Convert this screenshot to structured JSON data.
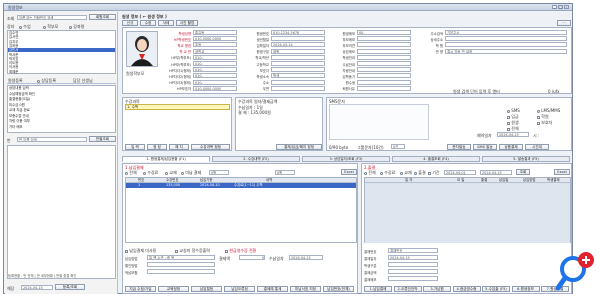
{
  "window": {
    "title": "원생정보",
    "controls": [
      "_",
      "□",
      "×"
    ]
  },
  "left": {
    "search_label": "조회",
    "search_placeholder": "이름 또는 전화번호 검색",
    "search_btn": "회원조회",
    "class_label": "강좌",
    "class_opts": [
      "수업",
      "학부모",
      "강좌명"
    ],
    "list_items": [
      "김수연",
      "김서연",
      "김지우",
      "김하윤",
      "김민서",
      "박서준",
      "박지호",
      "이도윤",
      "이서윤",
      "최예준"
    ],
    "selected_index": 4,
    "tab_a": "원생등록",
    "tab_b": "상담등록",
    "tab_c": "담당 선생님",
    "info_rows": [
      "상담내용 입력",
      "수납예정금액 확인",
      "출결현황(오늘)",
      "미수금 0원",
      "교재 지급 완료",
      "보충수업 안내",
      "차량 이용 여부",
      "기타 메모"
    ],
    "search2_label": "반",
    "search2_placeholder": "반 이름 검색",
    "search2_btn": "반별조회",
    "status_text": "등록현황 : 반 전체 | 반 세부현황 | 반별 출결 확인",
    "date_label": "해당",
    "date_value": "2024-04-15",
    "date_btn": "등록/조회"
  },
  "main": {
    "section_title": "원생 정보 ( ← 원생 정보 )",
    "toolbar": [
      "신규",
      "수정",
      "삭제",
      "사진 촬영"
    ],
    "more": "···",
    "photo_caption": "원생학부모",
    "fields_col1": [
      {
        "label": "학생성명",
        "value": "홍길동"
      },
      {
        "label": "HP학생번호",
        "value": "010-0000-0000"
      },
      {
        "label": "학교 명칭",
        "value": "초등"
      },
      {
        "label": "학 교 반",
        "value": "새학교"
      },
      {
        "label": "HP부(학부모)",
        "value": "010-"
      },
      {
        "label": "HP모(학부모)",
        "value": "010-"
      },
      {
        "label": "HP자녀1(형제)",
        "value": "010-"
      },
      {
        "label": "HP자녀2(형제)",
        "value": "010-"
      },
      {
        "label": "HP자녀3(형제)",
        "value": "010-"
      },
      {
        "label": "HP보호자",
        "value": "010-0000-0000"
      }
    ],
    "fields_col2": [
      {
        "label": "원생번호",
        "value": "010-1234-5678"
      },
      {
        "label": "생년월일",
        "value": ""
      },
      {
        "label": "입학일자",
        "value": "2024-03-14"
      },
      {
        "label": "원생구분",
        "value": "재원"
      },
      {
        "label": "학교/학년",
        "value": ""
      },
      {
        "label": "고등학교",
        "value": ""
      },
      {
        "label": "보호자",
        "value": ""
      },
      {
        "label": "학생소속",
        "value": "학생"
      },
      {
        "label": "주소",
        "value": ""
      },
      {
        "label": "우편",
        "value": ""
      }
    ],
    "fields_col3": [
      {
        "label": "원생메모",
        "value": "00-"
      },
      {
        "label": "부모메모",
        "value": ""
      },
      {
        "label": "부모의견",
        "value": ""
      },
      {
        "label": "상담메모",
        "value": ""
      },
      {
        "label": "학생안내",
        "value": ""
      },
      {
        "label": "수납안내",
        "value": ""
      },
      {
        "label": "차량안내",
        "value": ""
      },
      {
        "label": "입학동기",
        "value": ""
      },
      {
        "label": "원수생",
        "value": ""
      },
      {
        "label": "퇴원사유",
        "value": ""
      }
    ],
    "right_top": [
      {
        "label": "주소검색",
        "value": "기본주소"
      },
      {
        "label": "상세주소",
        "value": ""
      },
      {
        "label": "학 원",
        "value": ""
      },
      {
        "label": "반 명",
        "value": "결시 자동 반 설정"
      }
    ],
    "right_note": "원생 검색 단어 입력 후 엔터",
    "right_count": "0 /ufx"
  },
  "mid": {
    "left_title": "수강과목",
    "left_row": "1. 수학",
    "left_btns": [
      "입 력",
      "정 정",
      "해 지",
      "수강과목 정정"
    ],
    "center_title": "수강과목 일자/결제금액",
    "center_lines": [
      "수납일자 : 1일",
      "결 제 : 135,000원"
    ],
    "center_btn": "결제/입금/해지 정정",
    "right_title": "SMS문자",
    "right_opts": [
      "SMS",
      "LMS/MMS",
      "입금",
      "학원",
      "원생",
      "보호자",
      "전체"
    ],
    "right_sub": [
      "예약일자",
      "2024-04-15",
      "시 :"
    ],
    "right_bottom": [
      "0/90 byte",
      "그룹문자(10건)",
      "0건",
      "문자발송",
      "SMS 발송",
      "상품결제",
      "시간대"
    ]
  },
  "tabs": [
    "1. 원생결제/납입현황 (F1)",
    "2. 수강내역 (F2)",
    "3. 상담일자/조회 (F3)",
    "4. 출결조회 (F4)",
    "5. 발송결과 (F5)"
  ],
  "lower_left": {
    "title": "1.납입결제",
    "filters": [
      "전체",
      "수강료",
      "교재",
      "미납 결제",
      "0원",
      "0원",
      "Excel"
    ],
    "headers": [
      "번호",
      "수강번호",
      "납입기한",
      "내역"
    ],
    "row": [
      "1",
      "135,000",
      "2024-04-10",
      "수강료(1~11) 수학"
    ],
    "bottom_chk": [
      "납입결제 미사용",
      "교실미 정수증출력",
      "현금영수증 전환"
    ],
    "form_rows": [
      {
        "label": "납입방법",
        "value": "일 팬 소관 : 중 목"
      },
      {
        "label": "할인방법",
        "value": ""
      },
      {
        "label": "적납보험",
        "value": ""
      }
    ],
    "pay_label": "결제액",
    "pay_value": "0",
    "date_label": "수납일자",
    "date_value": "2024-04-15",
    "btns": [
      "지급 수정/가입",
      "교육정정",
      "납입철정",
      "납입오류정",
      "결제예 통계",
      "미납서표 지정",
      "납입번호(전체)"
    ]
  },
  "lower_right": {
    "title": "2.출결",
    "filters": [
      "전체",
      "수강료",
      "교재",
      "출결",
      "기간",
      "2024-04-01",
      "2024-04-15",
      "조회",
      "Excel"
    ],
    "headers": [
      "일 자",
      "요 일",
      "출결",
      "납입일",
      "납입방법",
      "학생결제"
    ],
    "form_rows": [
      {
        "label": "결제번호",
        "value": "결제번호"
      },
      {
        "label": "결재일자",
        "value": "2024-04-15"
      },
      {
        "label": "학생구분",
        "value": ""
      },
      {
        "label": "결제금액",
        "value": ""
      },
      {
        "label": "결제메모",
        "value": ""
      }
    ],
    "btns": [
      "1.납입결제",
      "2.오류안전작",
      "3.가납원",
      "4.현금영수증",
      "5.수입출 (F5)",
      "6.원생정보",
      "7.원생출결"
    ]
  },
  "colors": {
    "accent": "#3b6fd8",
    "red": "#c8102e",
    "selected": "#3a66c6",
    "zoom": "#1e73e8"
  },
  "icons": [
    "window-icon",
    "person-photo-icon",
    "zoom-in-icon"
  ]
}
